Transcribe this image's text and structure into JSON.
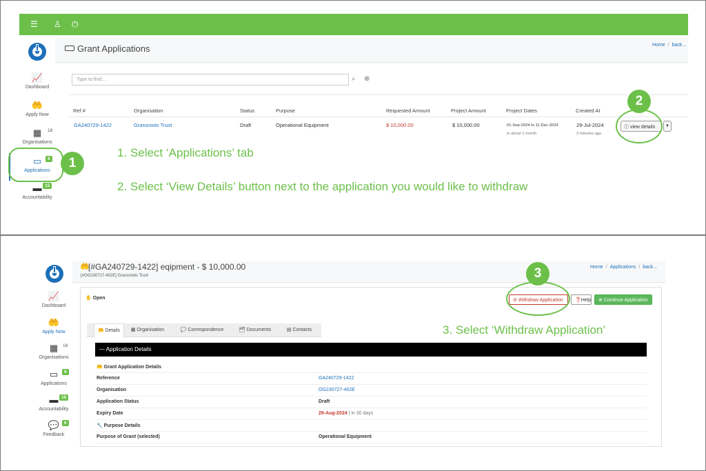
{
  "panel1": {
    "sidebar": {
      "items": [
        {
          "label": "Dashboard",
          "icon": "chart-icon",
          "badge": ""
        },
        {
          "label": "Apply Now",
          "icon": "hand-money-icon",
          "badge": ""
        },
        {
          "label": "Organisations",
          "icon": "building-icon",
          "badge": "18"
        },
        {
          "label": "Applications",
          "icon": "card-icon",
          "badge": "9"
        },
        {
          "label": "Accountability",
          "icon": "wallet-icon",
          "badge": "15"
        }
      ]
    },
    "page_title": "Grant Applications",
    "breadcrumb": {
      "home": "Home",
      "back": "back..."
    },
    "search": {
      "placeholder": "Type to find..."
    },
    "table": {
      "headers": [
        "Ref #",
        "Organisation",
        "Status",
        "Purpose",
        "Requested Amount",
        "Project Amount",
        "Project Dates",
        "Created At"
      ],
      "row": {
        "ref": "GA240729-1422",
        "organisation": "Grassroots Trust",
        "status": "Draft",
        "purpose": "Operational Equipment",
        "requested": "$ 10,000.00",
        "project_amount": "$ 10,000.00",
        "dates": "01-Sep-2024 to 11-Dec-2024",
        "dates_rel": "in about 1 month",
        "created": "29-Jul-2024",
        "created_rel": "3 minutes ago"
      },
      "view_details_label": "view details"
    },
    "callouts": {
      "one": "1",
      "two": "2"
    },
    "instructions": {
      "step1": "1. Select ‘Applications’ tab",
      "step2": "2. Select ‘View Details’ button next to the application you would like to withdraw"
    }
  },
  "panel2": {
    "sidebar": {
      "items": [
        {
          "label": "Dashboard",
          "badge": ""
        },
        {
          "label": "Apply Now",
          "badge": ""
        },
        {
          "label": "Organisations",
          "badge": "18"
        },
        {
          "label": "Applications",
          "badge": "9"
        },
        {
          "label": "Accountability",
          "badge": "15"
        },
        {
          "label": "Feedback",
          "badge": "6"
        }
      ]
    },
    "title": "[#GA240729-1422] eqipment - $ 10,000.00",
    "subtitle": "[#OG230727-402E] Grassroots Trust",
    "breadcrumb": {
      "home": "Home",
      "applications": "Applications",
      "back": "back..."
    },
    "status": "Open",
    "buttons": {
      "withdraw": "Withdraw Application",
      "help": "Help",
      "continue": "Continue Application"
    },
    "tabs": [
      "Details",
      "Organisation",
      "Correspondence",
      "Documents",
      "Contacts"
    ],
    "section_title": "Application Details",
    "subsection1": "Grant Application Details",
    "fields": [
      {
        "key": "Reference",
        "value": "GA240729-1422"
      },
      {
        "key": "Organisation",
        "value": "OG230727-402E"
      },
      {
        "key": "Application Status",
        "value": "Draft"
      },
      {
        "key": "Expiry Date",
        "value": "29-Aug-2024",
        "extra": "| in 30 days"
      }
    ],
    "subsection2": "Purpose Details",
    "purpose": {
      "key": "Purpose of Grant (selected)",
      "value": "Operational Equipment"
    },
    "callout": "3",
    "instruction": "3. Select ‘Withdraw Application’"
  }
}
